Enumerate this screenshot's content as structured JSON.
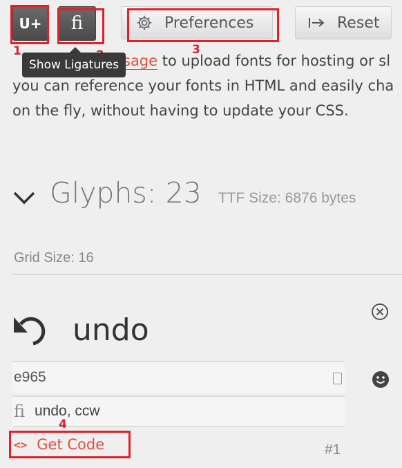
{
  "toolbar": {
    "unicode_label": "U+",
    "ligature_label": "fi",
    "preferences_label": "Preferences",
    "reset_label": "Reset"
  },
  "tooltip": {
    "text": "Show Ligatures"
  },
  "annotations": {
    "n1": "1",
    "n2": "2",
    "n3": "3",
    "n4": "4"
  },
  "intro": {
    "link_text": "sage",
    "line1_rest": " to upload fonts for hosting or sl",
    "line2": "you can reference your fonts in HTML and easily cha",
    "line3": "on the fly, without having to update your CSS."
  },
  "glyphs": {
    "title": "Glyphs: 23",
    "ttf_size": "TTF Size: 6876 bytes",
    "grid_size": "Grid Size: 16"
  },
  "glyph": {
    "name": "undo",
    "code": "e965",
    "ligatures": "undo, ccw",
    "get_code_label": "Get Code",
    "index": "#1"
  },
  "colors": {
    "accent": "#e0503a",
    "annotation": "#e0202a",
    "tooltip_bg": "#3a3a3a"
  }
}
